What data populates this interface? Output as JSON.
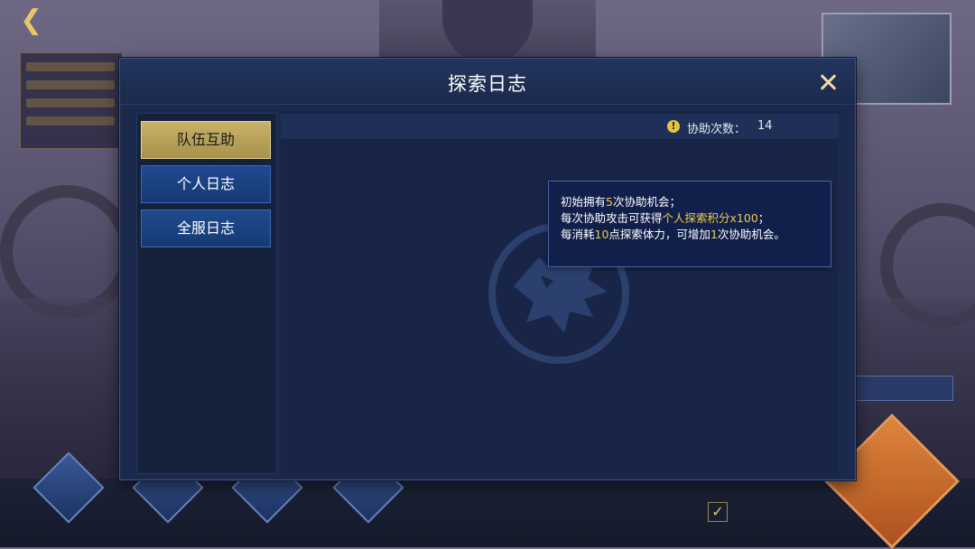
{
  "dialog": {
    "title": "探索日志",
    "close_icon": "close-icon"
  },
  "nav": {
    "items": [
      {
        "label": "队伍互助",
        "active": true
      },
      {
        "label": "个人日志",
        "active": false
      },
      {
        "label": "全服日志",
        "active": false
      }
    ]
  },
  "assist": {
    "label": "协助次数：",
    "value": "14",
    "icon": "exclamation-icon"
  },
  "tooltip": {
    "line1_a": "初始拥有",
    "line1_num": "5",
    "line1_b": "次协助机会；",
    "line2_a": "每次协助攻击可获得",
    "line2_hl": "个人探索积分x100",
    "line2_b": "；",
    "line3_a": "每消耗",
    "line3_num": "10",
    "line3_b": "点探索体力，可增加",
    "line3_num2": "1",
    "line3_c": "次协助机会。"
  },
  "colors": {
    "accent_gold": "#c8b26a",
    "highlight": "#f2c94c",
    "nav_blue": "#1f4a8e",
    "panel_bg": "#1b2a4c"
  }
}
